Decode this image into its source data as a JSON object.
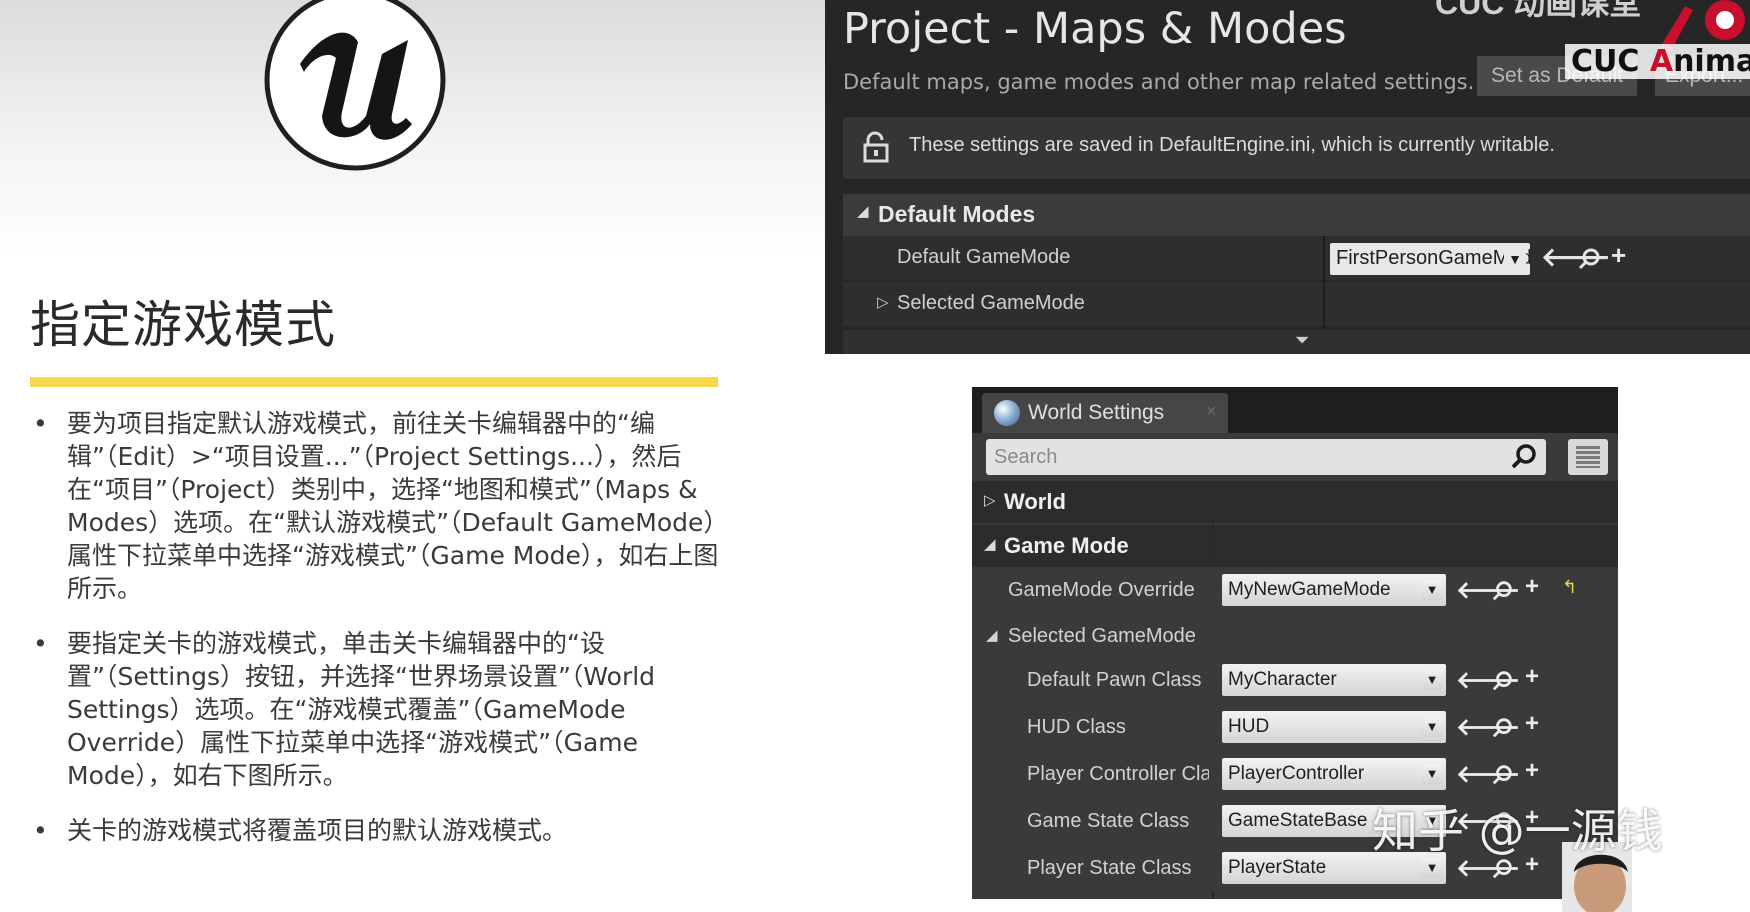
{
  "slide": {
    "title": "指定游戏模式",
    "bullets": [
      "要为项目指定默认游戏模式，前往关卡编辑器中的“编辑”（Edit）>“项目设置...”（Project Settings...），然后在“项目”（Project）类别中，选择“地图和模式”（Maps & Modes）选项。在“默认游戏模式”（Default GameMode）属性下拉菜单中选择“游戏模式”（Game Mode），如右上图所示。",
      "要指定关卡的游戏模式，单击关卡编辑器中的“设置”（Settings）按钮，并选择“世界场景设置”（World Settings）选项。在“游戏模式覆盖”（GameMode Override）属性下拉菜单中选择“游戏模式”（Game Mode），如右下图所示。",
      "关卡的游戏模式将覆盖项目的默认游戏模式。"
    ],
    "bullet_char": "•",
    "accent_color": "#f7d84a"
  },
  "project_settings": {
    "title": "Project - Maps & Modes",
    "subtitle": "Default maps, game modes and other map related settings.",
    "set_default_label": "Set as Default",
    "export_label": "Export...",
    "notice": "These settings are saved in DefaultEngine.ini, which is currently writable.",
    "section": "Default Modes",
    "rows": {
      "default_gamemode_label": "Default GameMode",
      "default_gamemode_value": "FirstPersonGameMode",
      "selected_gamemode_label": "Selected GameMode"
    },
    "icons": [
      "lock-icon",
      "arrow-left-icon",
      "magnifier-icon",
      "plus-icon",
      "expand-down-icon"
    ]
  },
  "watermarks": {
    "top_text": "CUC 动画课堂",
    "cuc_logo_prefix": "CUC ",
    "cuc_logo_a": "A",
    "cuc_logo_rest": "nima",
    "zhihu": "知乎 @一源钱"
  },
  "world_settings": {
    "tab_label": "World Settings",
    "tab_close": "×",
    "search_placeholder": "Search",
    "categories": {
      "world": "World",
      "game_mode": "Game Mode"
    },
    "gamemode_override_label": "GameMode Override",
    "gamemode_override_value": "MyNewGameMode",
    "selected_gamemode_label": "Selected GameMode",
    "class_rows": [
      {
        "label": "Default Pawn Class",
        "value": "MyCharacter"
      },
      {
        "label": "HUD Class",
        "value": "HUD"
      },
      {
        "label": "Player Controller Cla",
        "value": "PlayerController"
      },
      {
        "label": "Game State Class",
        "value": "GameStateBase"
      },
      {
        "label": "Player State Class",
        "value": "PlayerState"
      }
    ]
  }
}
